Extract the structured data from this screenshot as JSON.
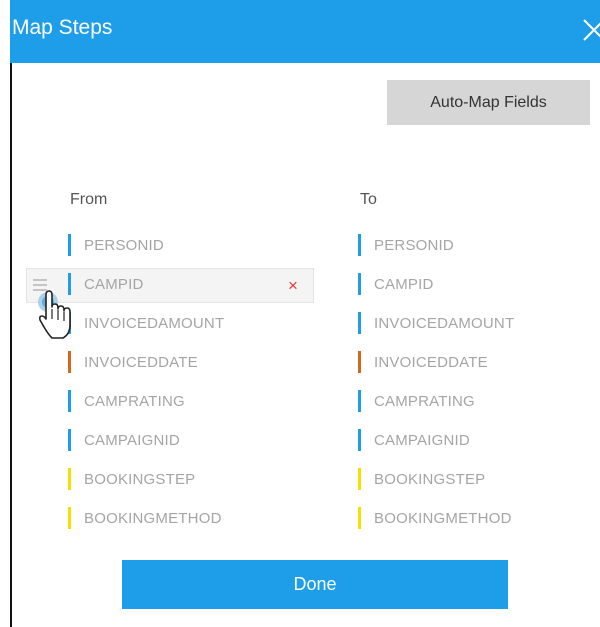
{
  "dialog": {
    "title": "Map Steps",
    "automap_label": "Auto-Map Fields",
    "done_label": "Done",
    "remove_symbol": "×"
  },
  "columns": {
    "from": "From",
    "to": "To"
  },
  "colors": {
    "accent": "#1e9ee8",
    "number_field": "#1e9ee8",
    "date_field": "#d2691e",
    "text_field": "#f5e100",
    "remove": "#e53935"
  },
  "from_fields": [
    {
      "label": "PERSONID"
    },
    {
      "label": "CAMPID"
    },
    {
      "label": "INVOICEDAMOUNT"
    },
    {
      "label": "INVOICEDDATE"
    },
    {
      "label": "CAMPRATING"
    },
    {
      "label": "CAMPAIGNID"
    },
    {
      "label": "BOOKINGSTEP"
    },
    {
      "label": "BOOKINGMETHOD"
    }
  ],
  "to_fields": [
    {
      "label": "PERSONID"
    },
    {
      "label": "CAMPID"
    },
    {
      "label": "INVOICEDAMOUNT"
    },
    {
      "label": "INVOICEDDATE"
    },
    {
      "label": "CAMPRATING"
    },
    {
      "label": "CAMPAIGNID"
    },
    {
      "label": "BOOKINGSTEP"
    },
    {
      "label": "BOOKINGMETHOD"
    }
  ],
  "field_types": [
    "number",
    "number",
    "number",
    "date",
    "number",
    "number",
    "text",
    "text"
  ],
  "icons": {
    "close": "close-icon",
    "drag": "drag-handle-icon",
    "cursor": "hand-cursor-icon"
  }
}
